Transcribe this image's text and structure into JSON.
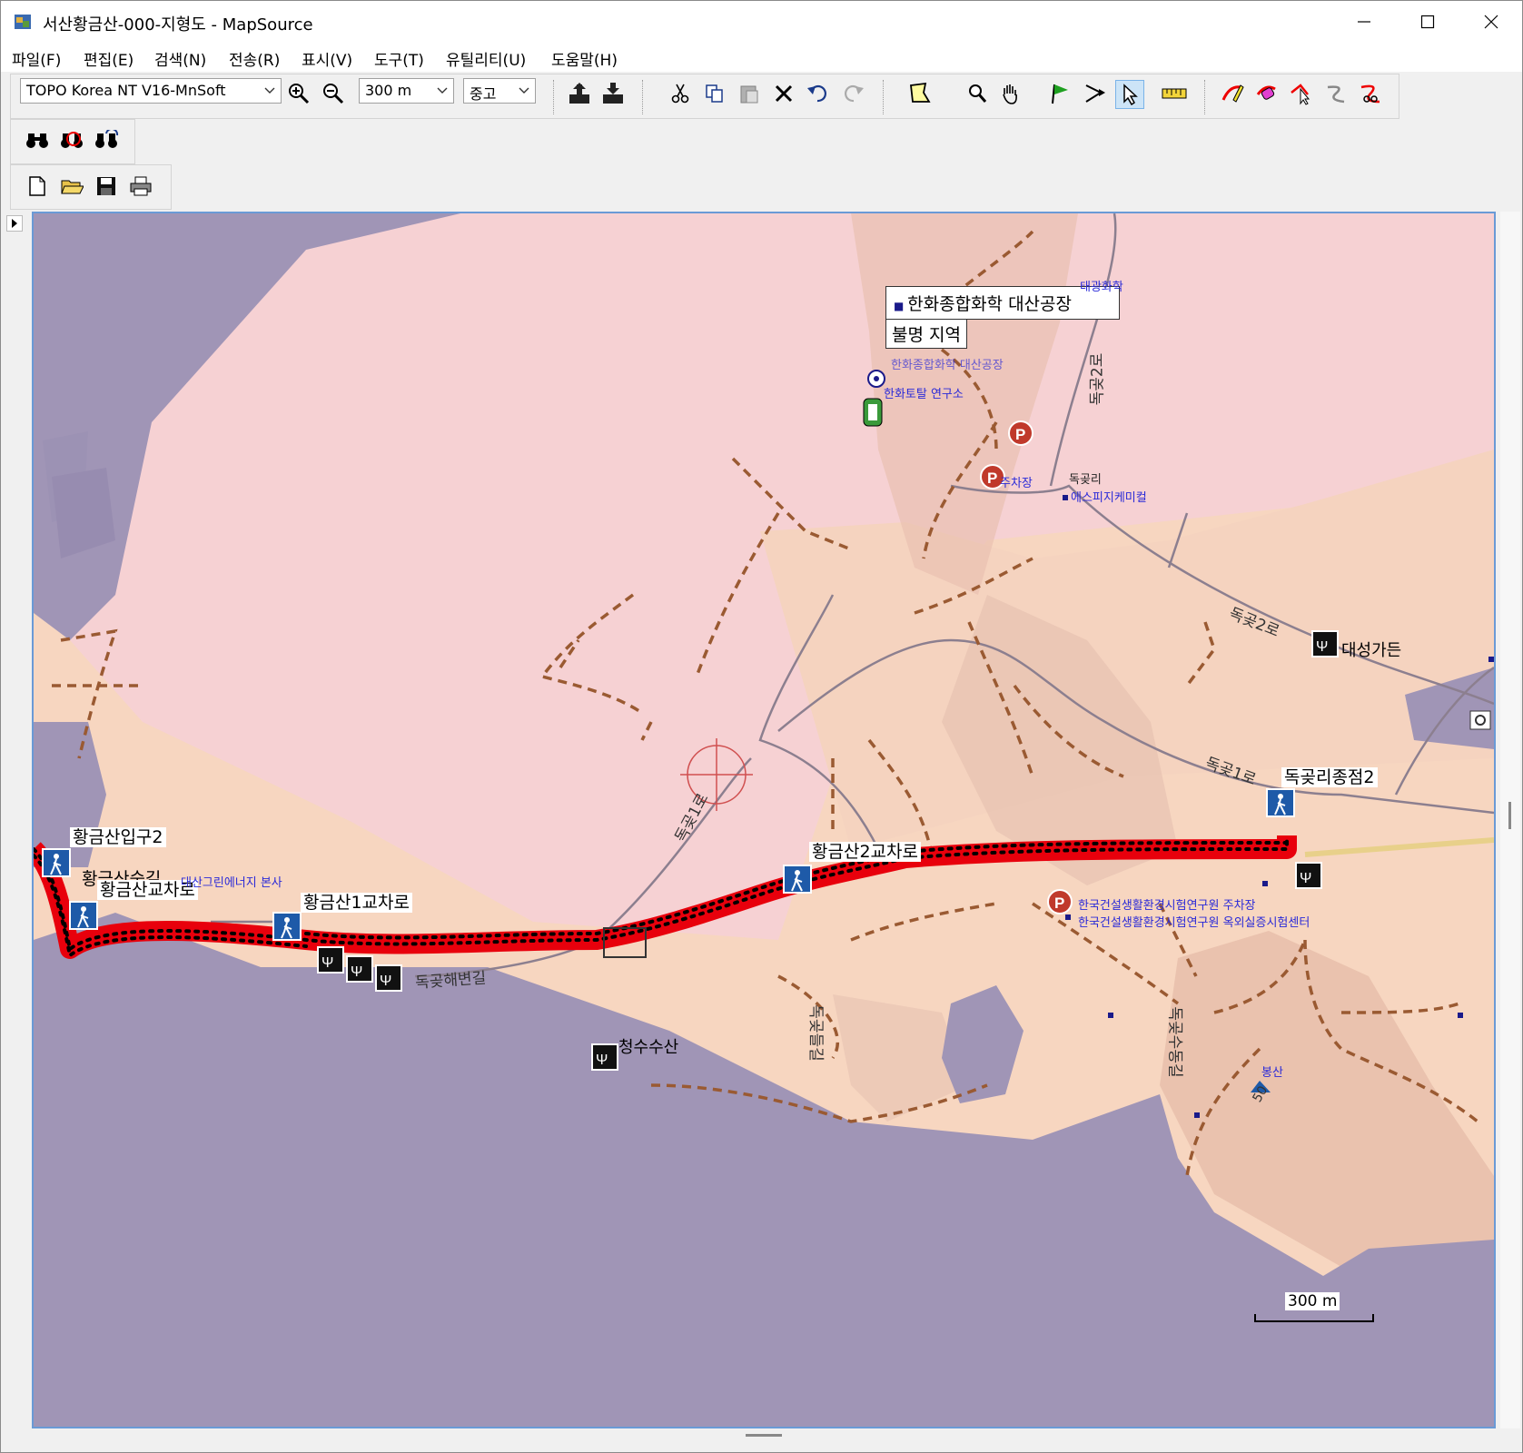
{
  "window": {
    "title": "서산황금산-000-지형도 - MapSource",
    "controls": [
      "minimize",
      "maximize",
      "close"
    ]
  },
  "menu": [
    {
      "label": "파일(F)"
    },
    {
      "label": "편집(E)"
    },
    {
      "label": "검색(N)"
    },
    {
      "label": "전송(R)"
    },
    {
      "label": "표시(V)"
    },
    {
      "label": "도구(T)"
    },
    {
      "label": "유틸리티(U)"
    },
    {
      "label": "도움말(H)"
    }
  ],
  "toolbar": {
    "map_product": "TOPO Korea NT V16-MnSoft",
    "zoom_scale": "300 m",
    "detail_level": "중고"
  },
  "map": {
    "tooltip": {
      "line1": "한화종합화학 대산공장",
      "line2": "불명 지역"
    },
    "waypoints": [
      {
        "label": "황금산입구2"
      },
      {
        "label": "황금산숲길"
      },
      {
        "label": "황금산교차로"
      },
      {
        "label": "황금산1교차로"
      },
      {
        "label": "황금산2교차로"
      },
      {
        "label": "독곶리종점2"
      }
    ],
    "poi_labels": [
      {
        "label": "태광화학"
      },
      {
        "label": "한화종합화학 대산공장"
      },
      {
        "label": "한화토탈 연구소"
      },
      {
        "label": "주차장"
      },
      {
        "label": "독곶리"
      },
      {
        "label": "에스피지케미컬"
      },
      {
        "label": "대성가든"
      },
      {
        "label": "대산그린에너지 본사"
      },
      {
        "label": "청수수산"
      },
      {
        "label": "한국건설생활환경시험연구원 주차장"
      },
      {
        "label": "한국건설생활환경시험연구원 옥외실증시험센터"
      },
      {
        "label": "봉산"
      }
    ],
    "road_labels": [
      {
        "label": "독곶2로"
      },
      {
        "label": "독곶2로"
      },
      {
        "label": "독곶1로"
      },
      {
        "label": "독곶해변길"
      },
      {
        "label": "독곶수동길"
      },
      {
        "label": "독곶들길"
      },
      {
        "label": "독곶1로"
      }
    ],
    "contour_label": "50",
    "scale_bar": "300 m",
    "colors": {
      "water": "#a095b6",
      "land": "#f7d6c0",
      "industrial": "#f6d1d3",
      "track": "#e8000c",
      "trail": "#9a5a32",
      "road": "#8c7f8f"
    }
  }
}
